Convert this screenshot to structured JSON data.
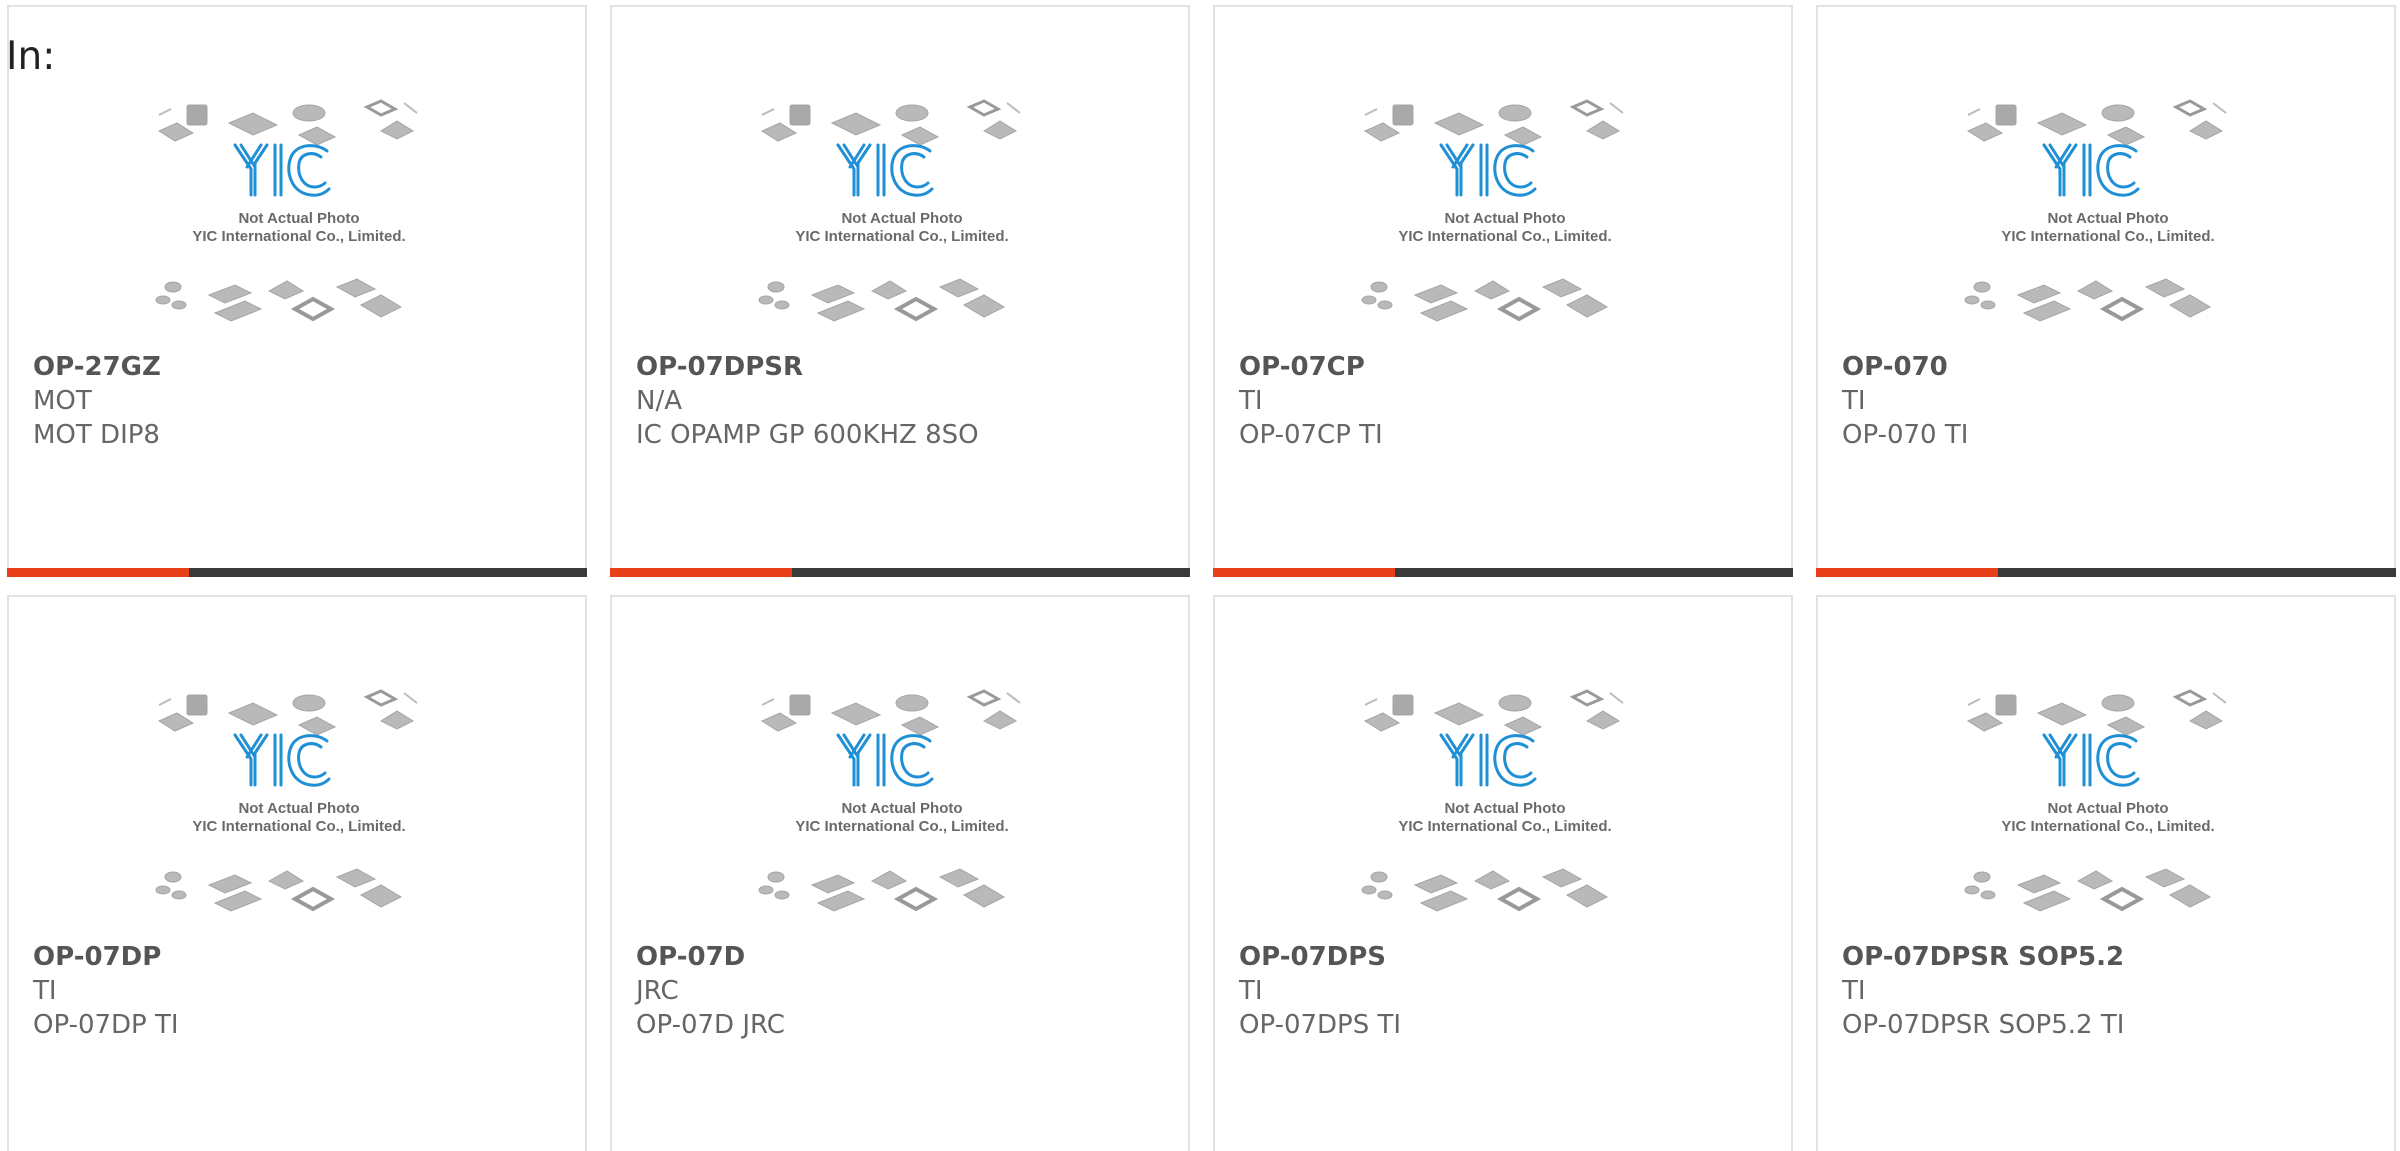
{
  "header": {
    "label": "In:"
  },
  "placeholder": {
    "line1": "Not Actual Photo",
    "line2": "YIC International Co., Limited."
  },
  "colors": {
    "accent": "#e8411a",
    "bar": "#3a3a3a",
    "logo_blue": "#1f8fd6"
  },
  "products": [
    {
      "part": "OP-27GZ",
      "manufacturer": "MOT",
      "description": "MOT DIP8",
      "show_bar": true
    },
    {
      "part": "OP-07DPSR",
      "manufacturer": "N/A",
      "description": "IC OPAMP GP 600KHZ 8SO",
      "show_bar": true
    },
    {
      "part": "OP-07CP",
      "manufacturer": "TI",
      "description": "OP-07CP TI",
      "show_bar": true
    },
    {
      "part": "OP-070",
      "manufacturer": "TI",
      "description": "OP-070 TI",
      "show_bar": true
    },
    {
      "part": "OP-07DP",
      "manufacturer": "TI",
      "description": "OP-07DP TI",
      "show_bar": false
    },
    {
      "part": "OP-07D",
      "manufacturer": "JRC",
      "description": "OP-07D JRC",
      "show_bar": false
    },
    {
      "part": "OP-07DPS",
      "manufacturer": "TI",
      "description": "OP-07DPS TI",
      "show_bar": false
    },
    {
      "part": "OP-07DPSR SOP5.2",
      "manufacturer": "TI",
      "description": "OP-07DPSR SOP5.2 TI",
      "show_bar": false
    }
  ]
}
